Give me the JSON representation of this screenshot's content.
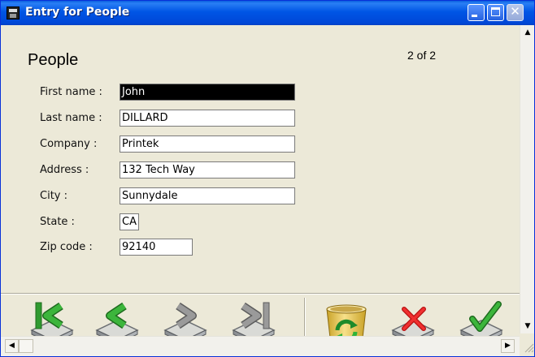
{
  "window": {
    "title": "Entry for People",
    "controls": {
      "minimize": "minimize",
      "maximize": "maximize",
      "close": "close"
    }
  },
  "form": {
    "title": "People",
    "record_counter": "2 of 2",
    "fields": [
      {
        "label": "First name :",
        "value": "John",
        "selected": true
      },
      {
        "label": "Last name :",
        "value": "DILLARD"
      },
      {
        "label": "Company :",
        "value": "Printek"
      },
      {
        "label": "Address :",
        "value": "132 Tech Way"
      },
      {
        "label": "City :",
        "value": "Sunnydale"
      },
      {
        "label": "State :",
        "value": "CA"
      },
      {
        "label": "Zip code :",
        "value": "92140"
      }
    ]
  },
  "toolbar": {
    "buttons": [
      {
        "name": "first-record-button",
        "icon": "first-record-icon",
        "accent": "#2f9a2f"
      },
      {
        "name": "previous-record-button",
        "icon": "previous-record-icon",
        "accent": "#2f9a2f"
      },
      {
        "name": "next-record-button",
        "icon": "next-record-icon",
        "accent": "#8a8a8a"
      },
      {
        "name": "last-record-button",
        "icon": "last-record-icon",
        "accent": "#8a8a8a"
      },
      {
        "name": "refresh-button",
        "icon": "recycle-bin-refresh-icon",
        "accent": "#e8c64a"
      },
      {
        "name": "cancel-button",
        "icon": "red-x-icon",
        "accent": "#e02020"
      },
      {
        "name": "confirm-button",
        "icon": "green-check-icon",
        "accent": "#2f9a2f"
      }
    ]
  },
  "colors": {
    "titlebar": "#0055E5",
    "window_bg": "#ECE9D8",
    "selected_field_bg": "#000000"
  }
}
